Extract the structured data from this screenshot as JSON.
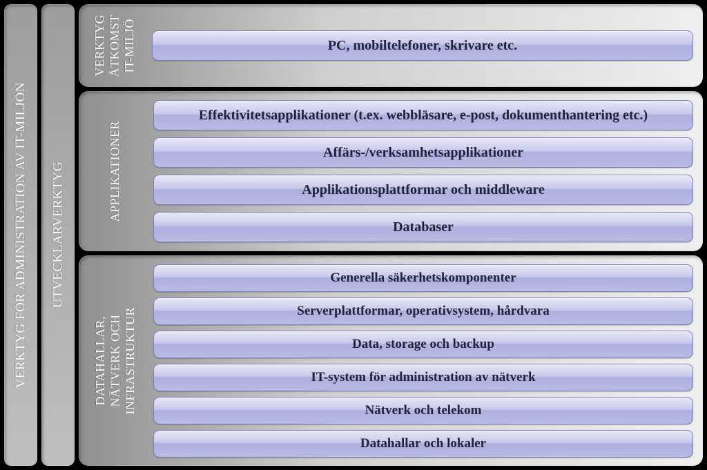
{
  "leftColumns": [
    {
      "id": "col-admin",
      "label": "VERKTYG FÖR ADMINISTRATION AV IT-MILJÖN"
    },
    {
      "id": "col-dev",
      "label": "UTVECKLARVERKTYG"
    }
  ],
  "sections": [
    {
      "id": "access",
      "label": "VERKTYG\nÅTKOMST\nIT-MILJÖ",
      "items": [
        "PC, mobiltelefoner, skrivare etc."
      ]
    },
    {
      "id": "applications",
      "label": "APPLIKATIONER",
      "items": [
        "Effektivitetsapplikationer (t.ex. webbläsare, e-post, dokumenthantering etc.)",
        "Affärs-/verksamhetsapplikationer",
        "Applikationsplattformar och middleware",
        "Databaser"
      ]
    },
    {
      "id": "infrastructure",
      "label": "DATAHALLAR,\nNÄTVERK OCH\nINFRASTRUKTUR",
      "items": [
        "Generella säkerhetskomponenter",
        "Serverplattformar, operativsystem, hårdvara",
        "Data, storage och backup",
        "IT-system för administration av nätverk",
        "Nätverk och telekom",
        "Datahallar och lokaler"
      ]
    }
  ]
}
